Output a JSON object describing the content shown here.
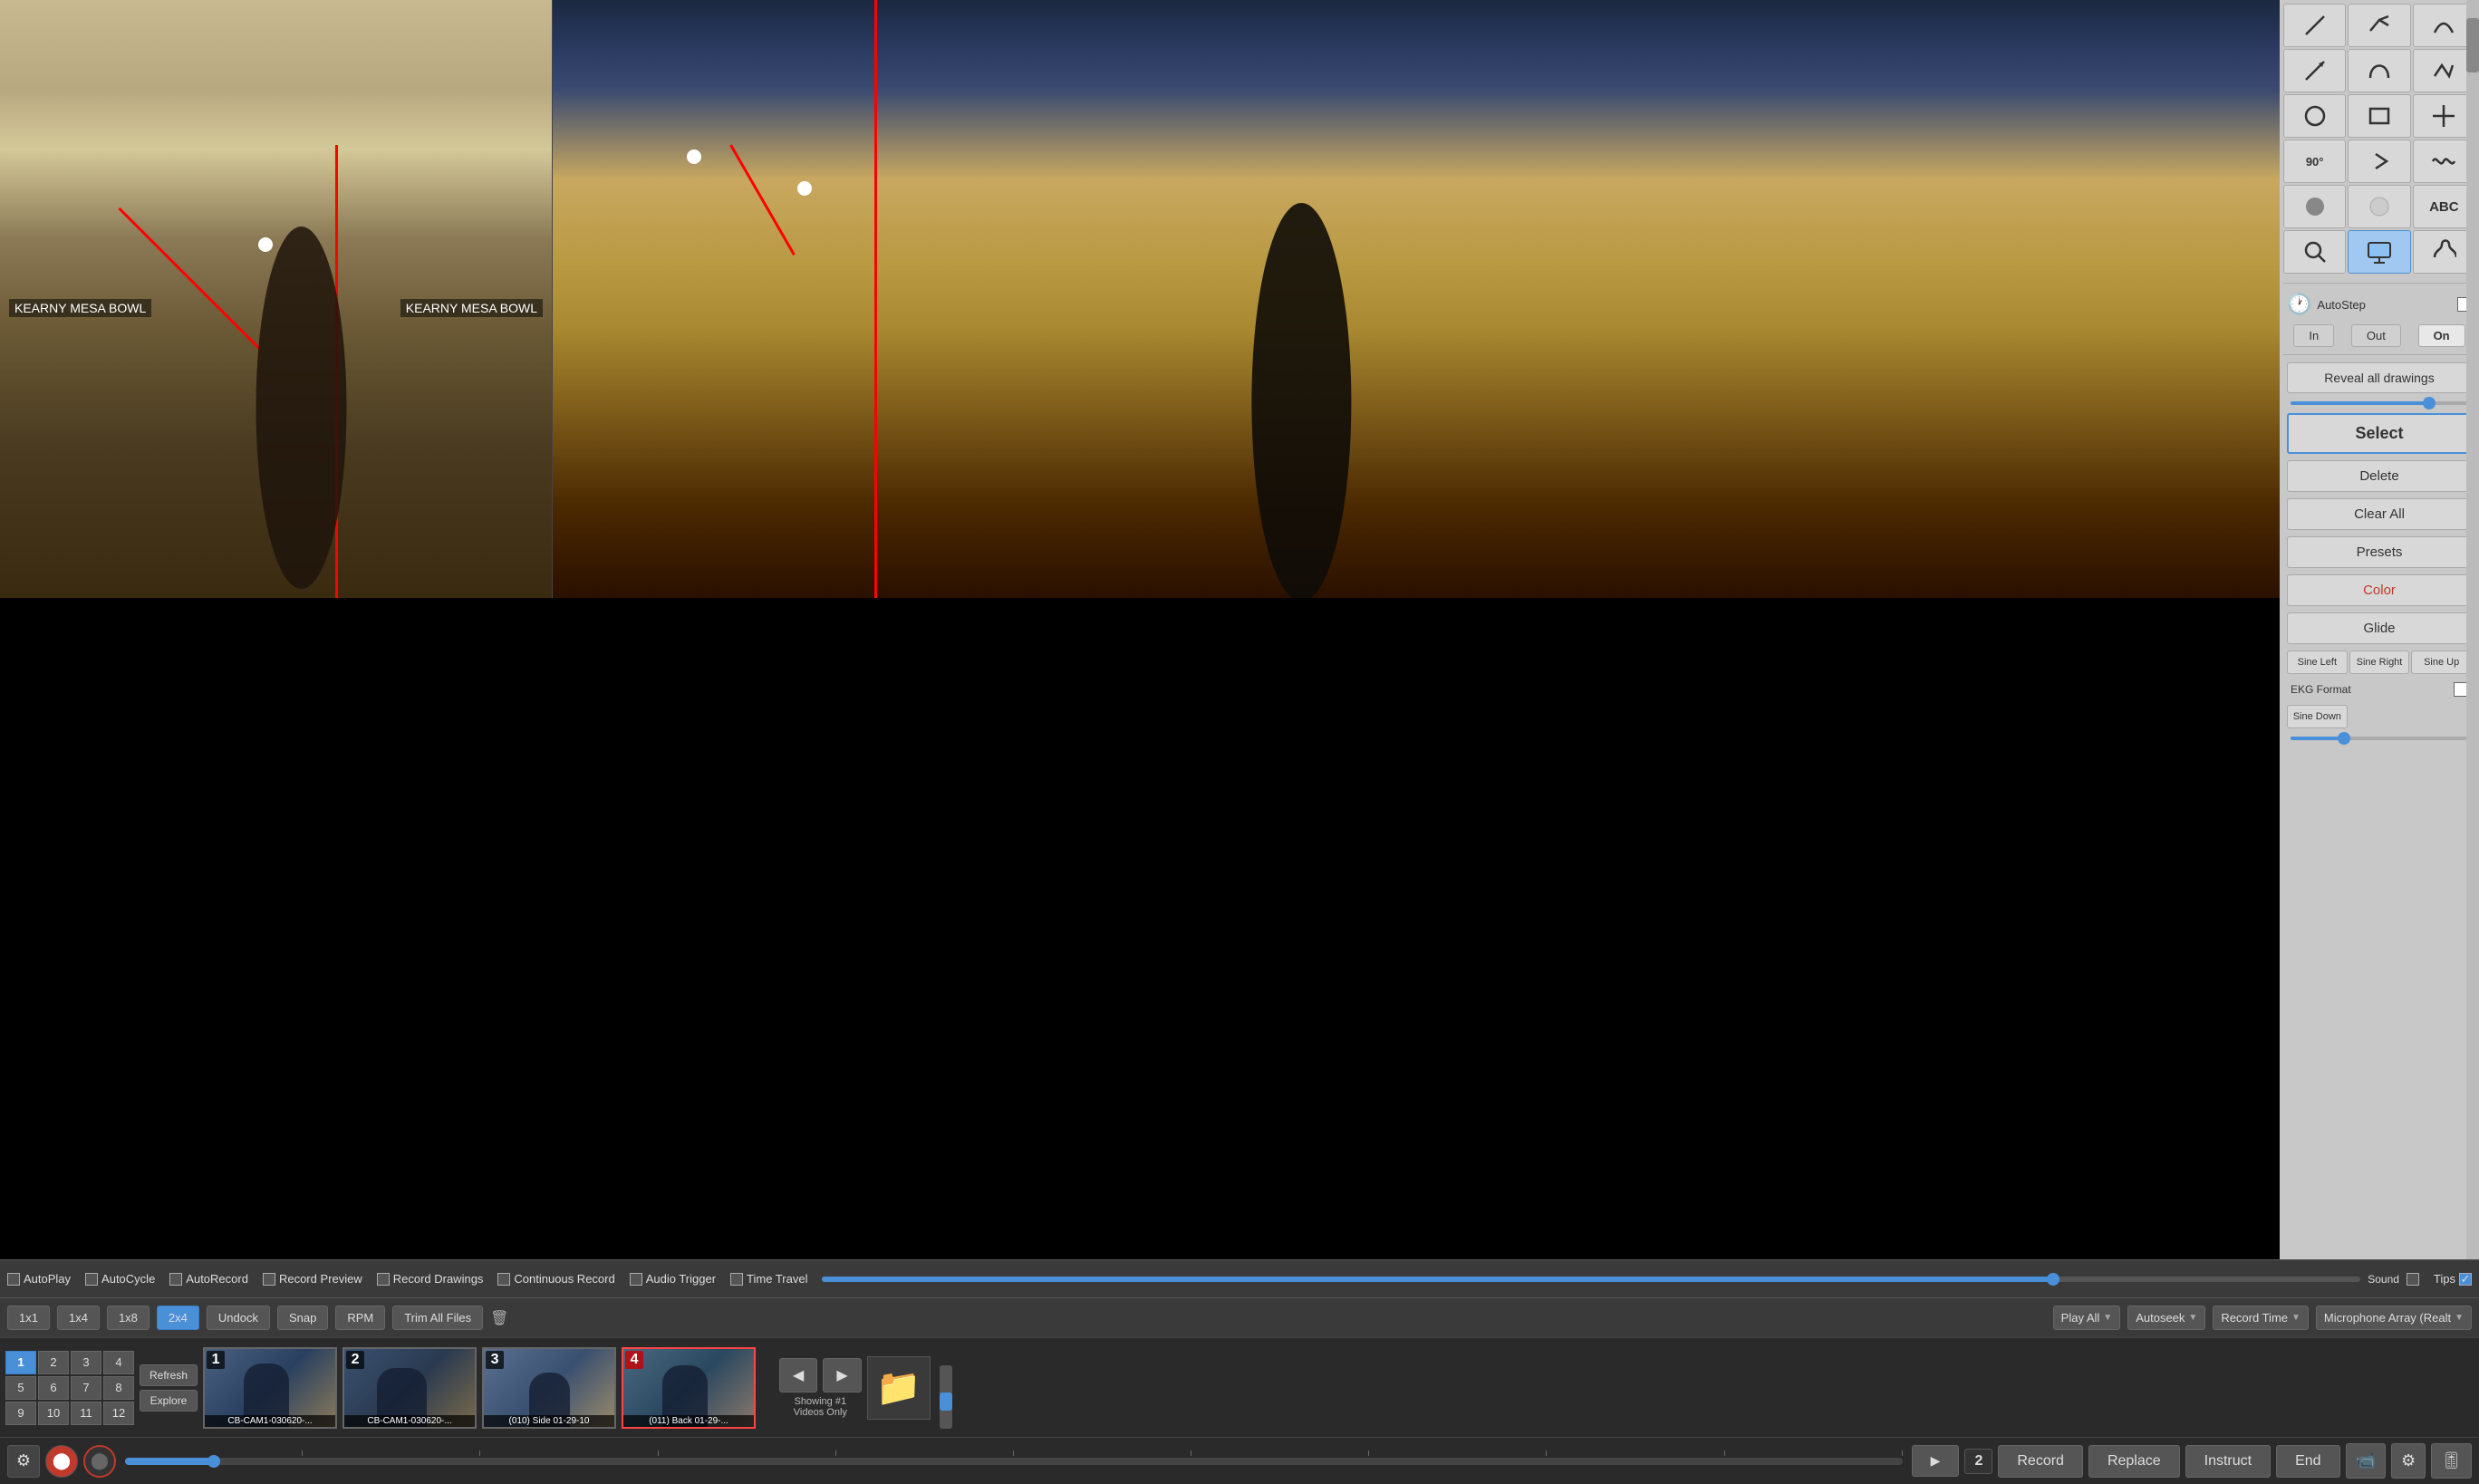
{
  "toolbar": {
    "autoplay_label": "AutoPlay",
    "autocycle_label": "AutoCycle",
    "autorecord_label": "AutoRecord",
    "record_preview_label": "Record Preview",
    "record_drawings_label": "Record Drawings",
    "continuous_record_label": "Continuous Record",
    "audio_trigger_label": "Audio Trigger",
    "time_travel_label": "Time Travel",
    "sound_label": "Sound",
    "tips_label": "Tips"
  },
  "controls": {
    "btn_1x1": "1x1",
    "btn_1x4": "1x4",
    "btn_1x8": "1x8",
    "btn_2x4": "2x4",
    "btn_undock": "Undock",
    "btn_snap": "Snap",
    "btn_rpm": "RPM",
    "btn_trim": "Trim All Files",
    "dropdown_play_all": "Play All",
    "dropdown_autoseek": "Autoseek",
    "dropdown_record_time": "Record Time",
    "dropdown_microphone": "Microphone Array (Realt"
  },
  "sidebar": {
    "autostep_label": "AutoStep",
    "in_label": "In",
    "out_label": "Out",
    "on_label": "On",
    "reveal_all_label": "Reveal all drawings",
    "select_label": "Select",
    "delete_label": "Delete",
    "clear_all_label": "Clear All",
    "presets_label": "Presets",
    "color_label": "Color",
    "glide_label": "Glide",
    "sine_left_label": "Sine Left",
    "sine_right_label": "Sine Right",
    "sine_up_label": "Sine Up",
    "ekg_format_label": "EKG Format",
    "sine_down_label": "Sine Down"
  },
  "thumbnails": {
    "refresh_label": "Refresh",
    "explore_label": "Explore",
    "showing_label": "Showing #1",
    "videos_only_label": "Videos Only",
    "items": [
      {
        "num": "1",
        "label": "CB-CAM1-030620-...",
        "active": false
      },
      {
        "num": "2",
        "label": "CB-CAM1-030620-...",
        "active": false
      },
      {
        "num": "3",
        "label": "(010) Side 01-29-10",
        "active": false
      },
      {
        "num": "4",
        "label": "(011) Back 01-29-...",
        "active": true
      }
    ]
  },
  "bottom_bar": {
    "play_label": "▶",
    "num_label": "2",
    "record_label": "Record",
    "replace_label": "Replace",
    "instruct_label": "Instruct",
    "end_label": "End"
  },
  "video_labels": {
    "left_bottom": "KEARNY MESA BOWL",
    "left_bottom2": "KEARNY MESA BOWL"
  },
  "current_tab_nums": {
    "tab1": "1",
    "tab2": "2",
    "tab3": "3",
    "tab4": "4",
    "tab5": "5",
    "tab6": "6",
    "tab7": "7",
    "tab8": "8",
    "tab9": "9",
    "tab10": "10",
    "tab11": "11",
    "tab12": "12",
    "selected": "1"
  }
}
